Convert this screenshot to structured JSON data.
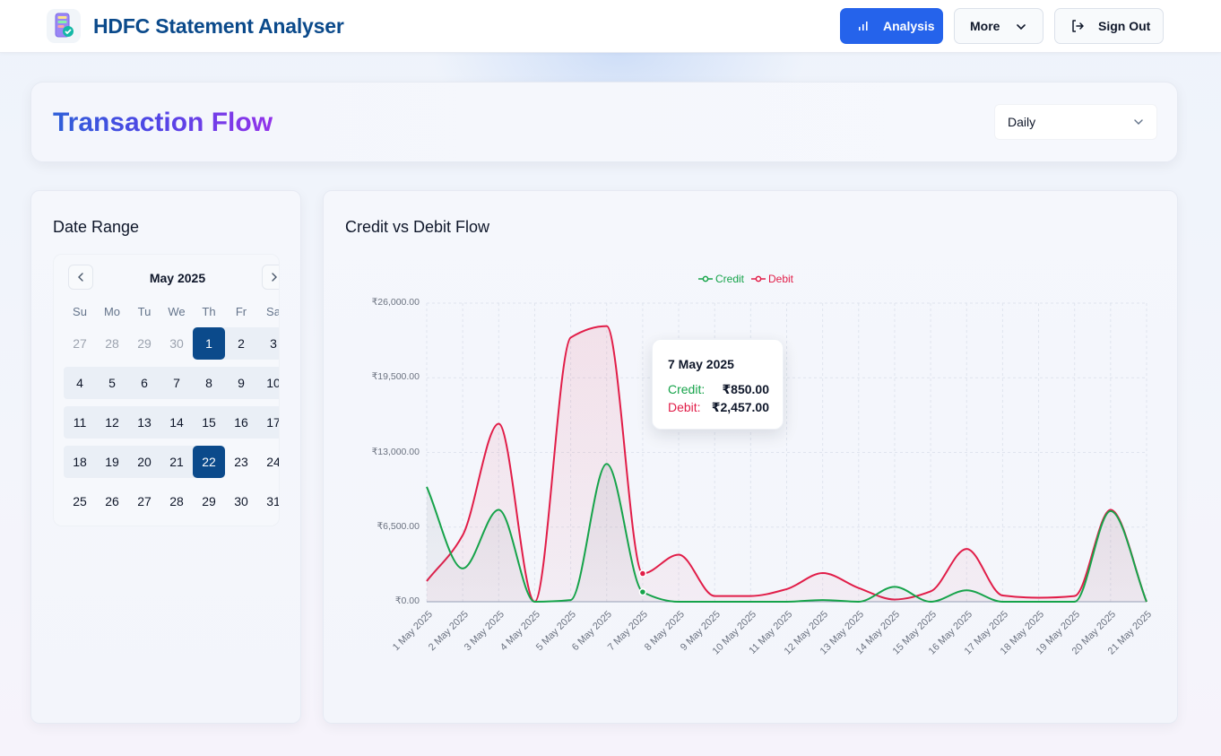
{
  "header": {
    "app_title": "HDFC Statement Analyser",
    "analysis_label": "Analysis",
    "more_label": "More",
    "signout_label": "Sign Out"
  },
  "title_card": {
    "title_part1": "Transaction",
    "title_part2": "Flow",
    "period_select": "Daily"
  },
  "date_range": {
    "title": "Date Range",
    "month": "May 2025",
    "weekdays": [
      "Su",
      "Mo",
      "Tu",
      "We",
      "Th",
      "Fr",
      "Sa"
    ],
    "weeks": [
      [
        "27",
        "28",
        "29",
        "30",
        "1",
        "2",
        "3"
      ],
      [
        "4",
        "5",
        "6",
        "7",
        "8",
        "9",
        "10"
      ],
      [
        "11",
        "12",
        "13",
        "14",
        "15",
        "16",
        "17"
      ],
      [
        "18",
        "19",
        "20",
        "21",
        "22",
        "23",
        "24"
      ],
      [
        "25",
        "26",
        "27",
        "28",
        "29",
        "30",
        "31"
      ]
    ],
    "outside_month_days": [
      "27",
      "28",
      "29",
      "30"
    ],
    "range_start": "1",
    "range_end": "22"
  },
  "chart": {
    "title": "Credit vs Debit Flow",
    "tooltip": {
      "date": "7 May 2025",
      "credit_label": "Credit:",
      "credit_value": "₹850.00",
      "debit_label": "Debit:",
      "debit_value": "₹2,457.00"
    }
  },
  "colors": {
    "credit": "#16a34a",
    "debit": "#e11d48",
    "primary": "#2563eb",
    "brand": "#0b4a8b"
  },
  "chart_data": {
    "type": "area",
    "x": [
      "1 May 2025",
      "2 May 2025",
      "3 May 2025",
      "4 May 2025",
      "5 May 2025",
      "6 May 2025",
      "7 May 2025",
      "8 May 2025",
      "9 May 2025",
      "10 May 2025",
      "11 May 2025",
      "12 May 2025",
      "13 May 2025",
      "14 May 2025",
      "15 May 2025",
      "16 May 2025",
      "17 May 2025",
      "18 May 2025",
      "19 May 2025",
      "20 May 2025",
      "21 May 2025"
    ],
    "series": [
      {
        "name": "Credit",
        "values": [
          10000,
          2900,
          8000,
          0,
          150,
          12000,
          850,
          0,
          0,
          0,
          0,
          150,
          0,
          1300,
          0,
          1000,
          0,
          0,
          0,
          7900,
          0
        ]
      },
      {
        "name": "Debit",
        "values": [
          1800,
          5800,
          15500,
          0,
          23000,
          24000,
          2457,
          4100,
          500,
          500,
          1100,
          2500,
          1200,
          200,
          900,
          4600,
          550,
          350,
          500,
          8000,
          0
        ]
      }
    ],
    "y_ticks": [
      "₹0.00",
      "₹6,500.00",
      "₹13,000.00",
      "₹19,500.00",
      "₹26,000.00"
    ],
    "ylim": [
      0,
      26000
    ],
    "grid": true,
    "legend_position": "top-center"
  }
}
